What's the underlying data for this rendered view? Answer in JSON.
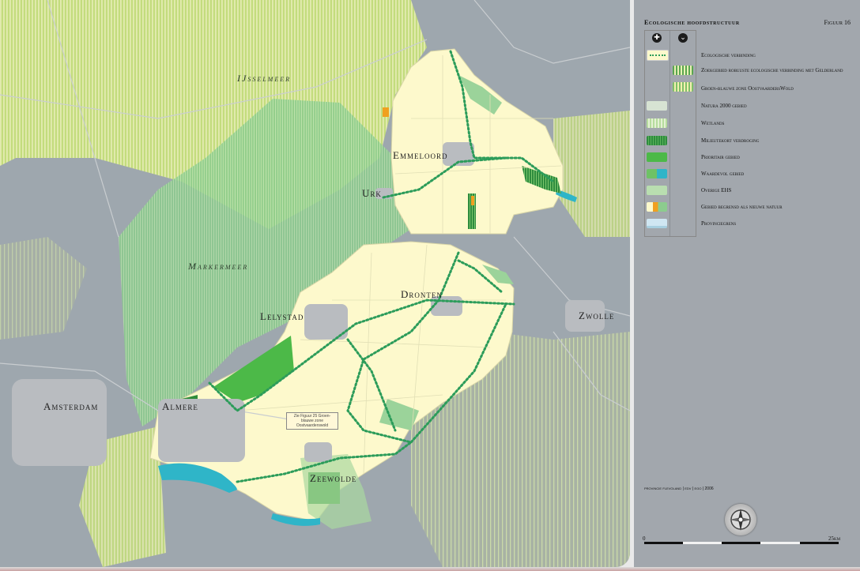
{
  "map": {
    "places": {
      "emmeloord": "Emmeloord",
      "urk": "Urk",
      "dronten": "Dronten",
      "lelystad": "Lelystad",
      "zwolle": "Zwolle",
      "amsterdam": "Amsterdam",
      "almere": "Almere",
      "zeewolde": "Zeewolde"
    },
    "waters": {
      "ijsselmeer": "IJsselmeer",
      "markermeer": "Markermeer"
    },
    "note": "Zie Figuur 25 Groen-blauwe zone Oostvaarderswold"
  },
  "panel": {
    "title": "Ecologische hoofdstructuur",
    "figure": "Figuur 16",
    "legend": [
      {
        "label": "Ecologische verbinding",
        "swatch": "dotted-green"
      },
      {
        "label": "Zoekgebied robuuste ecologische verbinding met Gelderland",
        "swatch": "striped-green-wide"
      },
      {
        "label": "Groen-blauwe zone OostvaardersWold",
        "swatch": "striped-green-yellow"
      },
      {
        "label": "Natura 2000 gebied",
        "swatch": "pale-blue-green"
      },
      {
        "label": "Wetlands",
        "swatch": "striped-light"
      },
      {
        "label": "Milieutekort verdroging",
        "swatch": "dark-hatched"
      },
      {
        "label": "Prioritair gebied",
        "swatch": "green"
      },
      {
        "label": "Waardevol gebied",
        "swatch": "green-cyan"
      },
      {
        "label": "Overige EHS",
        "swatch": "light-green"
      },
      {
        "label": "Gebied begrensd als nieuwe natuur",
        "swatch": "orange-green"
      },
      {
        "label": "Provinciegrens",
        "swatch": "light-blue"
      }
    ],
    "credit": "provincie flevoland | edv | ego | 2006",
    "scale": {
      "start": "0",
      "end": "25km"
    }
  },
  "colors": {
    "background": "#9aa3ab",
    "polder": "#fdf9cc",
    "ehs": "#b9deb0",
    "prioritair": "#4cb948",
    "waardevol": "#2fb5c8",
    "route": "#2c9c5a"
  }
}
